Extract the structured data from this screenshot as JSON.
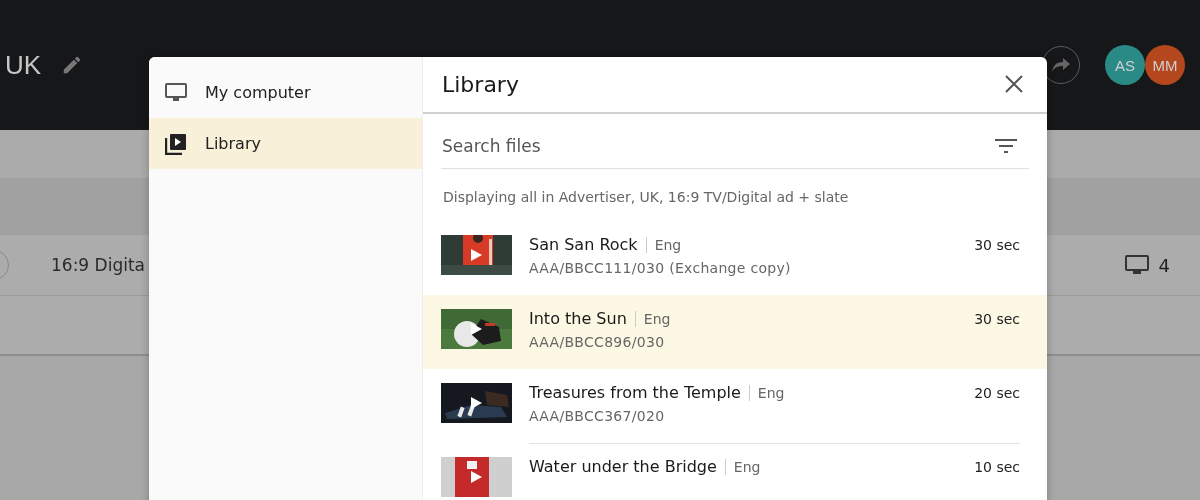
{
  "header": {
    "title": "UK",
    "avatars": [
      {
        "initials": "AS",
        "color": "#2a8a86"
      },
      {
        "initials": "MM",
        "color": "#b5471f"
      }
    ]
  },
  "background_row": {
    "selected": false,
    "name": "16:9 Digita",
    "screens": "4"
  },
  "dialog": {
    "sidebar": {
      "items": [
        {
          "label": "My computer",
          "kind": "computer",
          "selected": false
        },
        {
          "label": "Library",
          "kind": "library",
          "selected": true
        }
      ]
    },
    "title": "Library",
    "search": {
      "placeholder": "Search files"
    },
    "summary": "Displaying all in Advertiser, UK, 16:9 TV/Digital ad + slate",
    "files": [
      {
        "title": "San San Rock",
        "language": "Eng",
        "code": "AAA/BBCC111/030 (Exchange copy)",
        "duration": "30 sec",
        "selected": false
      },
      {
        "title": "Into the Sun",
        "language": "Eng",
        "code": "AAA/BBCC896/030",
        "duration": "30 sec",
        "selected": true
      },
      {
        "title": "Treasures from the Temple",
        "language": "Eng",
        "code": "AAA/BBCC367/020",
        "duration": "20 sec",
        "selected": false
      },
      {
        "title": "Water under the Bridge",
        "language": "Eng",
        "duration": "10 sec",
        "selected": false
      }
    ]
  }
}
